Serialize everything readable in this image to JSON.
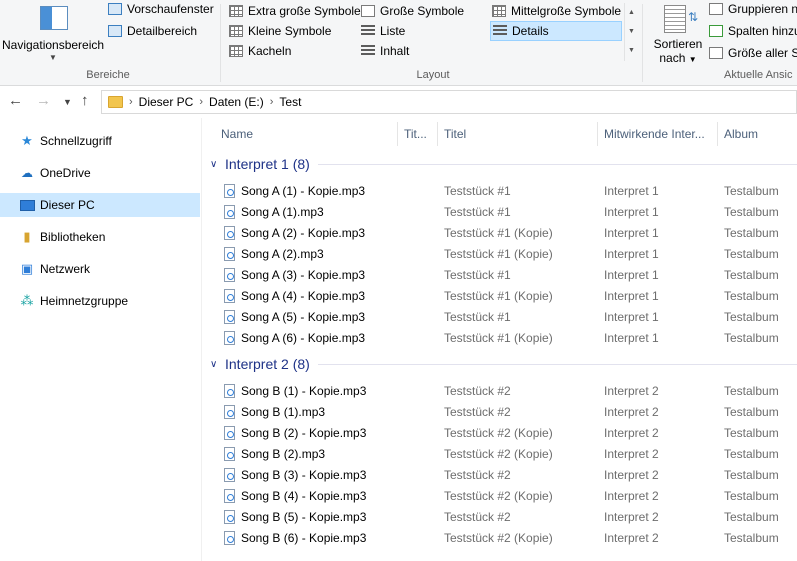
{
  "ribbon": {
    "bereiche": {
      "label": "Bereiche",
      "navigation_button": "Navigationsbereich",
      "preview_pane": "Vorschaufenster",
      "details_pane": "Detailbereich"
    },
    "layout": {
      "label": "Layout",
      "options": [
        {
          "label": "Extra große Symbole",
          "icon": "extra-large-icons-icon"
        },
        {
          "label": "Große Symbole",
          "icon": "large-icons-icon"
        },
        {
          "label": "Mittelgroße Symbole",
          "icon": "medium-icons-icon"
        },
        {
          "label": "Kleine Symbole",
          "icon": "small-icons-icon"
        },
        {
          "label": "Liste",
          "icon": "list-icon"
        },
        {
          "label": "Details",
          "icon": "details-icon",
          "selected": true
        },
        {
          "label": "Kacheln",
          "icon": "tiles-icon"
        },
        {
          "label": "Inhalt",
          "icon": "content-icon"
        }
      ]
    },
    "current_view": {
      "label": "Aktuelle Ansic",
      "sort_line1": "Sortieren",
      "sort_line2": "nach",
      "group_by": "Gruppieren n",
      "add_columns": "Spalten hinzu",
      "size_all": "Größe aller Sp"
    }
  },
  "address": {
    "breadcrumbs": [
      "Dieser PC",
      "Daten (E:)",
      "Test"
    ]
  },
  "sidebar": {
    "items": [
      {
        "label": "Schnellzugriff",
        "icon": "star-icon"
      },
      {
        "label": "OneDrive",
        "icon": "cloud-icon"
      },
      {
        "label": "Dieser PC",
        "icon": "computer-icon",
        "selected": true
      },
      {
        "label": "Bibliotheken",
        "icon": "library-icon"
      },
      {
        "label": "Netzwerk",
        "icon": "network-icon"
      },
      {
        "label": "Heimnetzgruppe",
        "icon": "homegroup-icon"
      }
    ]
  },
  "columns": [
    "Name",
    "Tit...",
    "Titel",
    "Mitwirkende Inter...",
    "Album"
  ],
  "groups": [
    {
      "title": "Interpret 1 (8)",
      "files": [
        {
          "name": "Song A (1) - Kopie.mp3",
          "title": "Teststück #1",
          "artist": "Interpret 1",
          "album": "Testalbum"
        },
        {
          "name": "Song A (1).mp3",
          "title": "Teststück #1",
          "artist": "Interpret 1",
          "album": "Testalbum"
        },
        {
          "name": "Song A (2) - Kopie.mp3",
          "title": "Teststück #1 (Kopie)",
          "artist": "Interpret 1",
          "album": "Testalbum"
        },
        {
          "name": "Song A (2).mp3",
          "title": "Teststück #1 (Kopie)",
          "artist": "Interpret 1",
          "album": "Testalbum"
        },
        {
          "name": "Song A (3) - Kopie.mp3",
          "title": "Teststück #1",
          "artist": "Interpret 1",
          "album": "Testalbum"
        },
        {
          "name": "Song A (4) - Kopie.mp3",
          "title": "Teststück #1 (Kopie)",
          "artist": "Interpret 1",
          "album": "Testalbum"
        },
        {
          "name": "Song A (5) - Kopie.mp3",
          "title": "Teststück #1",
          "artist": "Interpret 1",
          "album": "Testalbum"
        },
        {
          "name": "Song A (6) - Kopie.mp3",
          "title": "Teststück #1 (Kopie)",
          "artist": "Interpret 1",
          "album": "Testalbum"
        }
      ]
    },
    {
      "title": "Interpret 2 (8)",
      "files": [
        {
          "name": "Song B (1) - Kopie.mp3",
          "title": "Teststück #2",
          "artist": "Interpret 2",
          "album": "Testalbum"
        },
        {
          "name": "Song B (1).mp3",
          "title": "Teststück #2",
          "artist": "Interpret 2",
          "album": "Testalbum"
        },
        {
          "name": "Song B (2) - Kopie.mp3",
          "title": "Teststück #2 (Kopie)",
          "artist": "Interpret 2",
          "album": "Testalbum"
        },
        {
          "name": "Song B (2).mp3",
          "title": "Teststück #2 (Kopie)",
          "artist": "Interpret 2",
          "album": "Testalbum"
        },
        {
          "name": "Song B (3) - Kopie.mp3",
          "title": "Teststück #2",
          "artist": "Interpret 2",
          "album": "Testalbum"
        },
        {
          "name": "Song B (4) - Kopie.mp3",
          "title": "Teststück #2 (Kopie)",
          "artist": "Interpret 2",
          "album": "Testalbum"
        },
        {
          "name": "Song B (5) - Kopie.mp3",
          "title": "Teststück #2",
          "artist": "Interpret 2",
          "album": "Testalbum"
        },
        {
          "name": "Song B (6) - Kopie.mp3",
          "title": "Teststück #2 (Kopie)",
          "artist": "Interpret 2",
          "album": "Testalbum"
        }
      ]
    }
  ],
  "colors": {
    "selection": "#cce8ff",
    "group_header": "#1e3287",
    "column_header": "#4c607a",
    "meta_text": "#6d6d6d"
  }
}
